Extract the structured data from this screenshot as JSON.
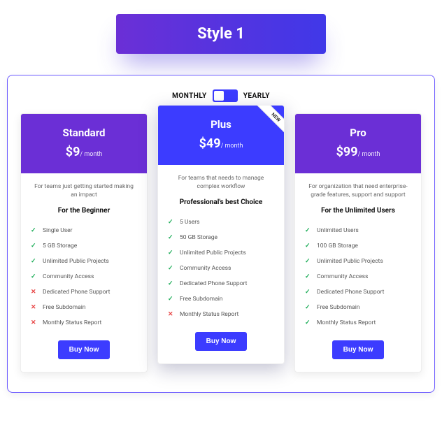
{
  "style_badge": "Style 1",
  "toggle": {
    "monthly": "MONTHLY",
    "yearly": "YEARLY"
  },
  "plans": [
    {
      "name": "Standard",
      "price": "$9",
      "period": "/ month",
      "desc": "For teams just getting started making an impact",
      "subtitle": "For the Beginner",
      "features": [
        {
          "ok": true,
          "text": "Single User"
        },
        {
          "ok": true,
          "text": "5 GB Storage"
        },
        {
          "ok": true,
          "text": "Unlimited Public Projects"
        },
        {
          "ok": true,
          "text": "Community Access"
        },
        {
          "ok": false,
          "text": "Dedicated Phone Support"
        },
        {
          "ok": false,
          "text": "Free Subdomain"
        },
        {
          "ok": false,
          "text": "Monthly Status Report"
        }
      ],
      "cta": "Buy Now"
    },
    {
      "name": "Plus",
      "price": "$49",
      "period": "/ month",
      "ribbon": "NEW",
      "desc": "For teams that needs to manage complex workflow",
      "subtitle": "Professional's best Choice",
      "features": [
        {
          "ok": true,
          "text": "5 Users"
        },
        {
          "ok": true,
          "text": "50 GB Storage"
        },
        {
          "ok": true,
          "text": "Unlimited Public Projects"
        },
        {
          "ok": true,
          "text": "Community Access"
        },
        {
          "ok": true,
          "text": "Dedicated Phone Support"
        },
        {
          "ok": true,
          "text": "Free Subdomain"
        },
        {
          "ok": false,
          "text": "Monthly Status Report"
        }
      ],
      "cta": "Buy Now"
    },
    {
      "name": "Pro",
      "price": "$99",
      "period": "/ month",
      "desc": "For organization that need enterprise-grade features, support and support",
      "subtitle": "For the Unlimited Users",
      "features": [
        {
          "ok": true,
          "text": "Unlimited Users"
        },
        {
          "ok": true,
          "text": "100 GB Storage"
        },
        {
          "ok": true,
          "text": "Unlimited Public Projects"
        },
        {
          "ok": true,
          "text": "Community Access"
        },
        {
          "ok": true,
          "text": "Dedicated Phone Support"
        },
        {
          "ok": true,
          "text": "Free Subdomain"
        },
        {
          "ok": true,
          "text": "Monthly Status Report"
        }
      ],
      "cta": "Buy Now"
    }
  ]
}
